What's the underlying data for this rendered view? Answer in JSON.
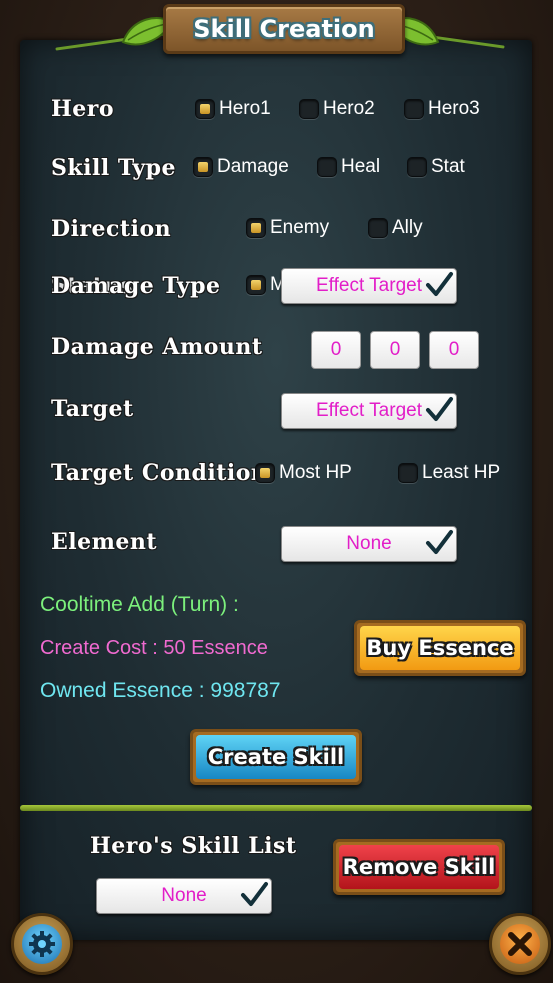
{
  "title": "Skill Creation",
  "hero": {
    "label": "Hero",
    "options": [
      {
        "label": "Hero1",
        "checked": true
      },
      {
        "label": "Hero2",
        "checked": false
      },
      {
        "label": "Hero3",
        "checked": false
      }
    ]
  },
  "skill_type": {
    "label": "Skill Type",
    "options": [
      {
        "label": "Damage",
        "checked": true
      },
      {
        "label": "Heal",
        "checked": false
      },
      {
        "label": "Stat",
        "checked": false
      }
    ]
  },
  "direction": {
    "label": "Direction",
    "options": [
      {
        "label": "Enemy",
        "checked": true
      },
      {
        "label": "Ally",
        "checked": false
      }
    ]
  },
  "damage_type": {
    "label": "Damage Type",
    "overlap_label": "Status",
    "option_partial": "M",
    "dropdown": "Effect Target"
  },
  "damage_amount": {
    "label": "Damage Amount",
    "digits": [
      "0",
      "0",
      "0"
    ]
  },
  "target": {
    "label": "Target",
    "dropdown": "Effect Target"
  },
  "target_condition": {
    "label": "Target Condition",
    "options": [
      {
        "label": "Most HP",
        "checked": true
      },
      {
        "label": "Least HP",
        "checked": false
      }
    ]
  },
  "element": {
    "label": "Element",
    "dropdown": "None"
  },
  "cooltime_text": "Cooltime Add (Turn) :",
  "create_cost_text": "Create Cost : 50 Essence",
  "owned_essence_text": "Owned Essence : 998787",
  "buy_essence_label": "Buy Essence",
  "create_skill_label": "Create Skill",
  "skill_list": {
    "label": "Hero's Skill List",
    "dropdown": "None"
  },
  "remove_skill_label": "Remove Skill",
  "colors": {
    "cooltime": "#7cf07c",
    "create_cost": "#f06ad0",
    "owned": "#6fe6f0",
    "dropdown_text": "#e21ec8"
  },
  "icons": {
    "settings": "gear-icon",
    "close": "close-icon",
    "check": "checkmark-icon"
  }
}
